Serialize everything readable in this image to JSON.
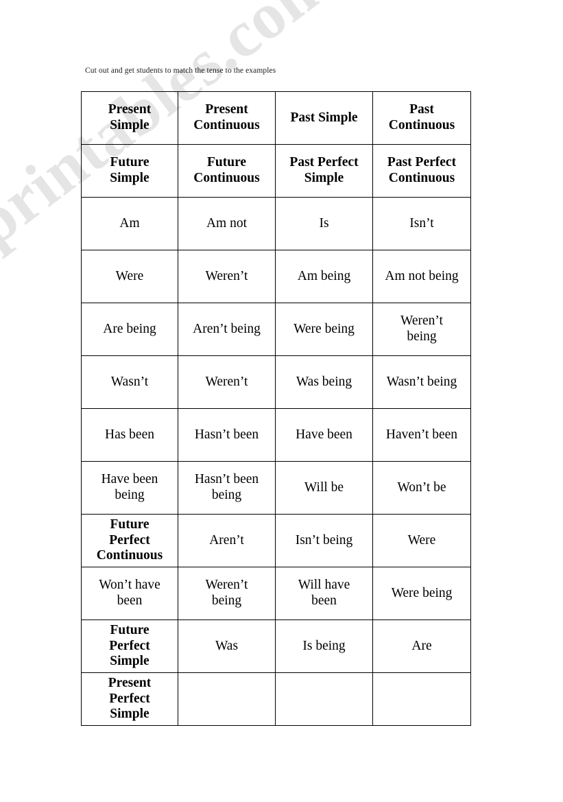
{
  "document": {
    "instruction": "Cut out and get students to match the tense to the examples",
    "watermark": "ESLprintables.com"
  },
  "table": {
    "rows": [
      [
        {
          "text": "Present\nSimple",
          "bold": true
        },
        {
          "text": "Present\nContinuous",
          "bold": true
        },
        {
          "text": "Past Simple",
          "bold": true
        },
        {
          "text": "Past\nContinuous",
          "bold": true
        }
      ],
      [
        {
          "text": "Future\nSimple",
          "bold": true
        },
        {
          "text": "Future\nContinuous",
          "bold": true
        },
        {
          "text": "Past Perfect\nSimple",
          "bold": true
        },
        {
          "text": "Past Perfect\nContinuous",
          "bold": true
        }
      ],
      [
        {
          "text": "Am",
          "bold": false
        },
        {
          "text": "Am not",
          "bold": false
        },
        {
          "text": "Is",
          "bold": false
        },
        {
          "text": "Isn’t",
          "bold": false
        }
      ],
      [
        {
          "text": "Were",
          "bold": false
        },
        {
          "text": "Weren’t",
          "bold": false
        },
        {
          "text": "Am being",
          "bold": false
        },
        {
          "text": "Am not being",
          "bold": false
        }
      ],
      [
        {
          "text": "Are being",
          "bold": false
        },
        {
          "text": "Aren’t being",
          "bold": false
        },
        {
          "text": "Were being",
          "bold": false
        },
        {
          "text": "Weren’t\nbeing",
          "bold": false
        }
      ],
      [
        {
          "text": "Wasn’t",
          "bold": false
        },
        {
          "text": "Weren’t",
          "bold": false
        },
        {
          "text": "Was being",
          "bold": false
        },
        {
          "text": "Wasn’t being",
          "bold": false
        }
      ],
      [
        {
          "text": "Has been",
          "bold": false
        },
        {
          "text": "Hasn’t been",
          "bold": false
        },
        {
          "text": "Have been",
          "bold": false
        },
        {
          "text": "Haven’t been",
          "bold": false
        }
      ],
      [
        {
          "text": "Have been\nbeing",
          "bold": false
        },
        {
          "text": "Hasn’t been\nbeing",
          "bold": false
        },
        {
          "text": "Will be",
          "bold": false
        },
        {
          "text": "Won’t be",
          "bold": false
        }
      ],
      [
        {
          "text": "Future\nPerfect\nContinuous",
          "bold": true
        },
        {
          "text": "Aren’t",
          "bold": false
        },
        {
          "text": "Isn’t being",
          "bold": false
        },
        {
          "text": "Were",
          "bold": false
        }
      ],
      [
        {
          "text": "Won’t have\nbeen",
          "bold": false
        },
        {
          "text": "Weren’t\nbeing",
          "bold": false
        },
        {
          "text": "Will have\nbeen",
          "bold": false
        },
        {
          "text": "Were being",
          "bold": false
        }
      ],
      [
        {
          "text": "Future\nPerfect\nSimple",
          "bold": true
        },
        {
          "text": "Was",
          "bold": false
        },
        {
          "text": "Is being",
          "bold": false
        },
        {
          "text": "Are",
          "bold": false
        }
      ],
      [
        {
          "text": "Present\nPerfect\nSimple",
          "bold": true
        },
        {
          "text": "",
          "bold": false
        },
        {
          "text": "",
          "bold": false
        },
        {
          "text": "",
          "bold": false
        }
      ]
    ]
  }
}
